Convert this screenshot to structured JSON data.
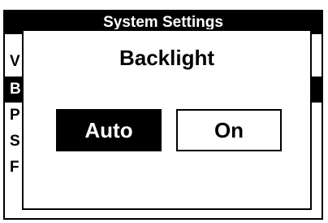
{
  "menu": {
    "title": "System Settings",
    "items": [
      {
        "label": "V",
        "selected": false
      },
      {
        "label": "B",
        "selected": true
      },
      {
        "label": "P",
        "selected": false
      },
      {
        "label": "S",
        "selected": false
      },
      {
        "label": "F",
        "selected": false
      }
    ]
  },
  "dialog": {
    "title": "Backlight",
    "options": [
      {
        "label": "Auto",
        "selected": true
      },
      {
        "label": "On",
        "selected": false
      }
    ]
  }
}
